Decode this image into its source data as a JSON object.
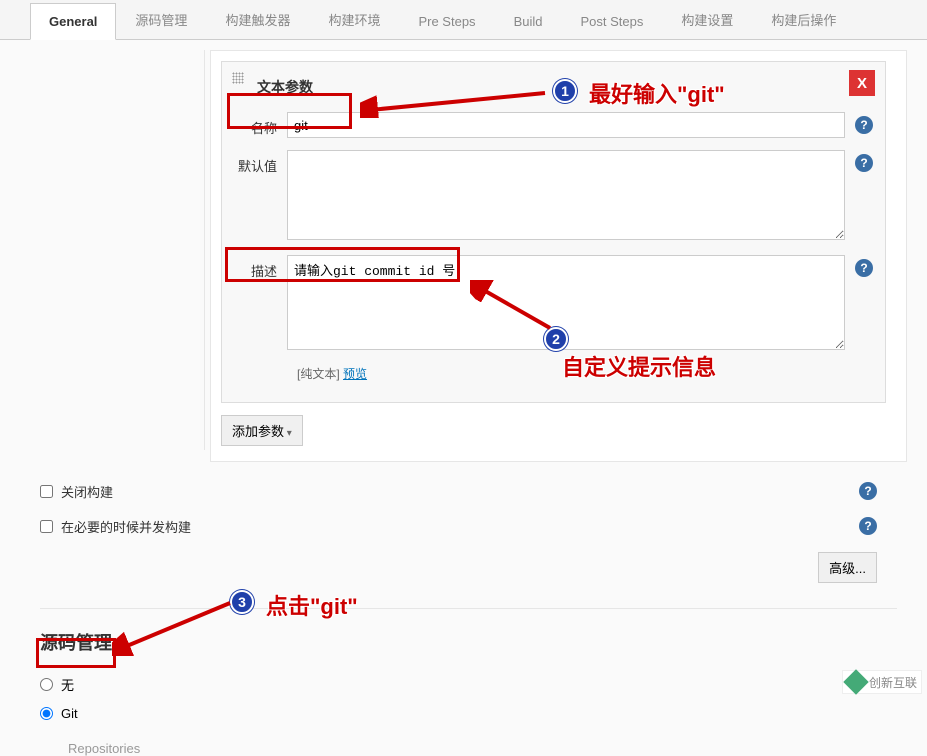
{
  "tabs": [
    {
      "label": "General",
      "active": true
    },
    {
      "label": "源码管理"
    },
    {
      "label": "构建触发器"
    },
    {
      "label": "构建环境"
    },
    {
      "label": "Pre Steps"
    },
    {
      "label": "Build"
    },
    {
      "label": "Post Steps"
    },
    {
      "label": "构建设置"
    },
    {
      "label": "构建后操作"
    }
  ],
  "param": {
    "group_title": "文本参数",
    "name_label": "名称",
    "name_value": "git",
    "default_label": "默认值",
    "default_value": "",
    "desc_label": "描述",
    "desc_value": "请输入git commit id 号",
    "hint_prefix": "[纯文本]",
    "hint_link": "预览"
  },
  "add_param_label": "添加参数",
  "checks": {
    "close_build": "关闭构建",
    "concurrent": "在必要的时候并发构建"
  },
  "advanced_label": "高级",
  "scm": {
    "section_title": "源码管理",
    "none_label": "无",
    "git_label": "Git",
    "repos_label": "Repositories"
  },
  "annotations": {
    "t1": "最好输入\"git\"",
    "t2": "自定义提示信息",
    "t3": "点击\"git\"",
    "n1": "1",
    "n2": "2",
    "n3": "3"
  },
  "watermark": "创新互联"
}
